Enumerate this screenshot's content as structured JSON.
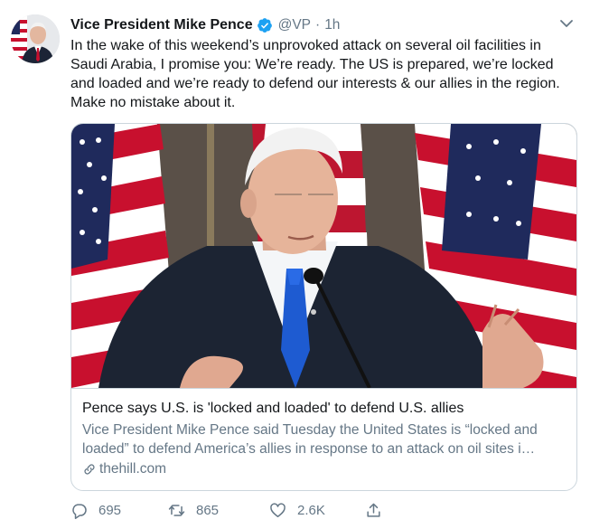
{
  "author": {
    "display_name": "Vice President Mike Pence",
    "handle": "@VP",
    "separator": "·",
    "time": "1h",
    "verified_icon": "verified-badge-icon",
    "avatar": "profile-photo-with-us-flag"
  },
  "tweet": {
    "text": "In the wake of this weekend’s unprovoked attack on several oil facilities in Saudi Arabia, I promise you: We’re ready. The US is prepared, we’re locked and loaded and we’re ready to defend our interests & our allies in the region. Make no mistake about it."
  },
  "card": {
    "image": "photo-pence-speaking-at-podium-with-us-flags",
    "title": "Pence says U.S. is 'locked and loaded' to defend U.S. allies",
    "description": "Vice President Mike Pence said Tuesday the United States is “locked and loaded” to defend America’s allies in response to an attack on oil sites i…",
    "domain": "thehill.com",
    "domain_icon": "link-icon"
  },
  "actions": {
    "reply_count": "695",
    "retweet_count": "865",
    "like_count": "2.6K",
    "reply_icon": "reply-icon",
    "retweet_icon": "retweet-icon",
    "like_icon": "heart-icon",
    "share_icon": "share-icon"
  },
  "colors": {
    "text_primary": "#14171a",
    "text_secondary": "#657786",
    "verified_blue": "#1da1f2",
    "border": "#ccd6dd",
    "flag_red": "#c8102e",
    "flag_blue": "#1f2a5c"
  }
}
